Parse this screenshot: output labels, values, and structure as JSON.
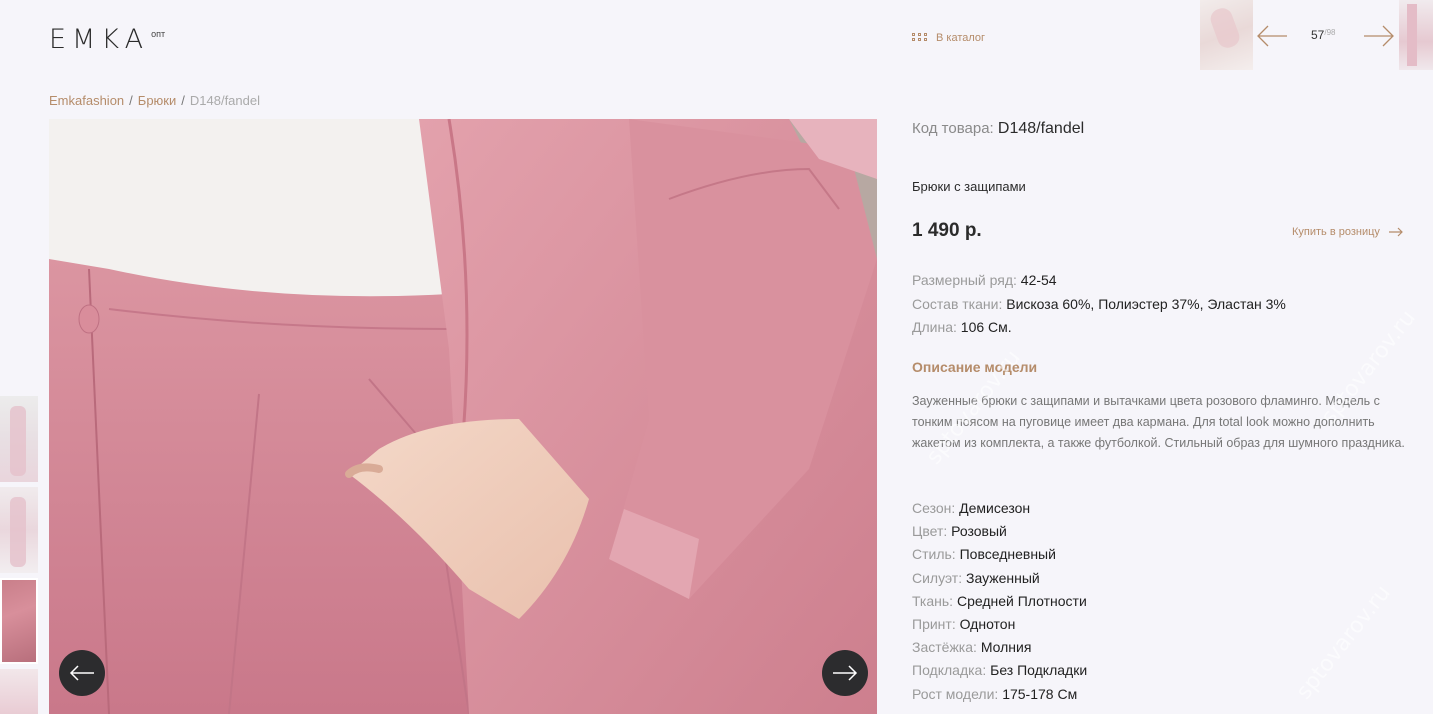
{
  "header": {
    "logo": "EMKA",
    "logo_sub": "опт",
    "catalog_link": "В каталог",
    "pager": {
      "current": "57",
      "total": "/98"
    }
  },
  "breadcrumb": {
    "items": [
      "Emkafashion",
      "Брюки",
      "D148/fandel"
    ],
    "separator": "/"
  },
  "product": {
    "code_label": "Код товара:",
    "code_value": "D148/fandel",
    "name": "Брюки с защипами",
    "price": "1 490 р.",
    "retail_link": "Купить в розницу",
    "specs": [
      {
        "label": "Размерный ряд:",
        "value": "42-54"
      },
      {
        "label": "Состав ткани:",
        "value": "Вискоза 60%, Полиэстер 37%, Эластан 3%"
      },
      {
        "label": "Длина:",
        "value": "106 См."
      }
    ],
    "description_title": "Описание модели",
    "description": "Зауженные брюки с защипами и вытачками цвета розового фламинго. Модель с тонким поясом на пуговице имеет два кармана. Для total look можно дополнить жакетом из комплекта, а также футболкой. Стильный образ для шумного праздника.",
    "details": [
      {
        "label": "Сезон:",
        "value": "Демисезон"
      },
      {
        "label": "Цвет:",
        "value": "Розовый"
      },
      {
        "label": "Стиль:",
        "value": "Повседневный"
      },
      {
        "label": "Силуэт:",
        "value": "Зауженный"
      },
      {
        "label": "Ткань:",
        "value": "Средней Плотности"
      },
      {
        "label": "Принт:",
        "value": "Однотон"
      },
      {
        "label": "Застёжка:",
        "value": "Молния"
      },
      {
        "label": "Подкладка:",
        "value": "Без Подкладки"
      },
      {
        "label": "Рост модели:",
        "value": "175-178 См"
      }
    ]
  },
  "watermark": "sptovarov.ru",
  "colors": {
    "accent": "#b58c6a",
    "background": "#f6f5fa",
    "button_dark": "#2c2c2e",
    "fabric_pink": "#d98d9b"
  },
  "icons": {
    "catalog": "grid-icon",
    "prev": "arrow-left-icon",
    "next": "arrow-right-icon",
    "retail": "arrow-right-icon"
  }
}
